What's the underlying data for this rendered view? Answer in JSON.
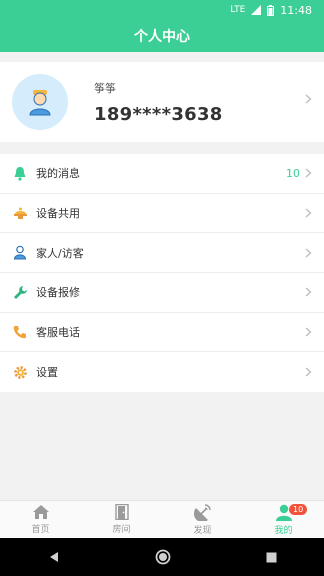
{
  "status_bar": {
    "network": "LTE",
    "time": "11:48"
  },
  "header": {
    "title": "个人中心"
  },
  "profile": {
    "nickname": "筝筝",
    "phone": "189****3638"
  },
  "menu": [
    {
      "label": "我的消息",
      "icon": "bell-icon",
      "count": "10"
    },
    {
      "label": "设备共用",
      "icon": "device-share-icon",
      "count": ""
    },
    {
      "label": "家人/访客",
      "icon": "person-icon",
      "count": ""
    },
    {
      "label": "设备报修",
      "icon": "wrench-icon",
      "count": ""
    },
    {
      "label": "客服电话",
      "icon": "phone-icon",
      "count": ""
    },
    {
      "label": "设置",
      "icon": "gear-icon",
      "count": ""
    }
  ],
  "tabs": [
    {
      "label": "首页",
      "icon": "home-icon"
    },
    {
      "label": "房间",
      "icon": "door-icon"
    },
    {
      "label": "发现",
      "icon": "discover-icon"
    },
    {
      "label": "我的",
      "icon": "user-icon",
      "badge": "10"
    }
  ],
  "colors": {
    "accent": "#3ccf95",
    "badge": "#f0533a"
  }
}
